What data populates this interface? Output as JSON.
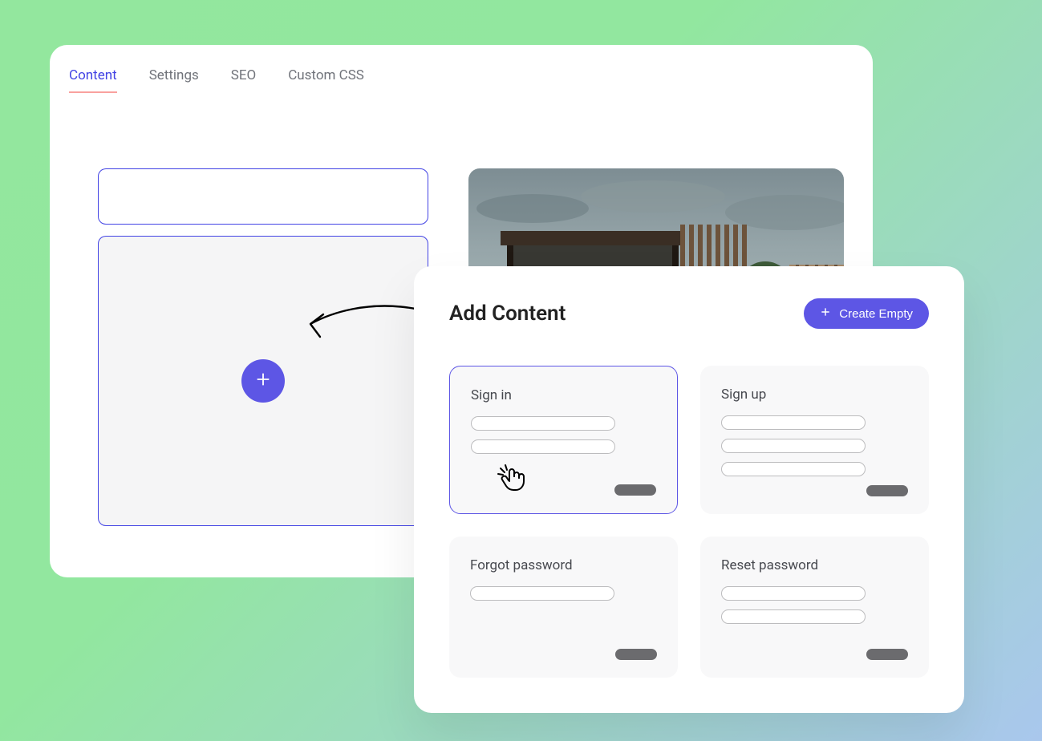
{
  "tabs": [
    "Content",
    "Settings",
    "SEO",
    "Custom CSS"
  ],
  "active_tab_index": 0,
  "modal": {
    "title": "Add Content",
    "create_button": "Create Empty"
  },
  "cards": [
    {
      "title": "Sign in",
      "fields": 2,
      "selected": true,
      "pointer": true
    },
    {
      "title": "Sign up",
      "fields": 3,
      "selected": false,
      "pointer": false
    },
    {
      "title": "Forgot password",
      "fields": 1,
      "selected": false,
      "pointer": false
    },
    {
      "title": "Reset password",
      "fields": 2,
      "selected": false,
      "pointer": false
    }
  ]
}
